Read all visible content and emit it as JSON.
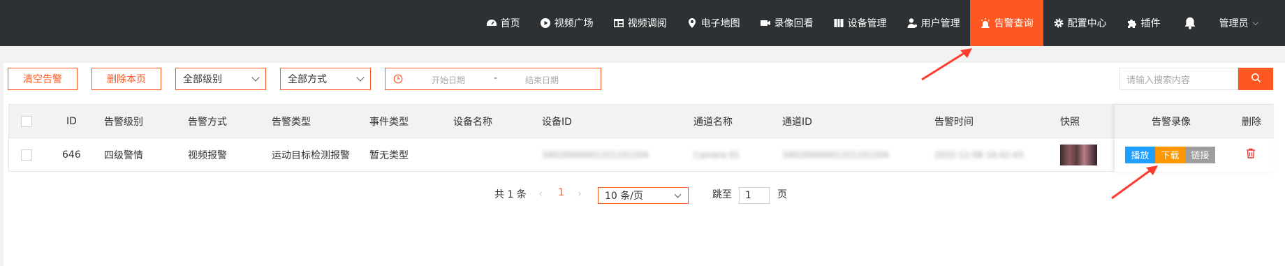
{
  "nav": {
    "items": [
      {
        "label": "首页",
        "icon": "dashboard-icon"
      },
      {
        "label": "视频广场",
        "icon": "play-circle-icon"
      },
      {
        "label": "视频调阅",
        "icon": "layout-icon"
      },
      {
        "label": "电子地图",
        "icon": "map-pin-icon"
      },
      {
        "label": "录像回看",
        "icon": "video-camera-icon"
      },
      {
        "label": "设备管理",
        "icon": "device-icon"
      },
      {
        "label": "用户管理",
        "icon": "user-icon"
      },
      {
        "label": "告警查询",
        "icon": "alarm-light-icon"
      },
      {
        "label": "配置中心",
        "icon": "gear-icon"
      },
      {
        "label": "插件",
        "icon": "puzzle-icon"
      }
    ],
    "active_label": "告警查询",
    "user": "管理员",
    "accent": "#ff5722",
    "bg": "#2e3133"
  },
  "toolbar": {
    "clear_label": "清空告警",
    "delete_page_label": "删除本页",
    "level_select": "全部级别",
    "method_select": "全部方式",
    "start_placeholder": "开始日期",
    "end_placeholder": "结束日期",
    "date_sep": "-",
    "search_placeholder": "请输入搜索内容"
  },
  "table": {
    "headers": {
      "id": "ID",
      "level": "告警级别",
      "method": "告警方式",
      "type": "告警类型",
      "event": "事件类型",
      "device_name": "设备名称",
      "device_id": "设备ID",
      "channel_name": "通道名称",
      "channel_id": "通道ID",
      "time": "告警时间",
      "snapshot": "快照",
      "record": "告警录像",
      "delete": "删除"
    },
    "row": {
      "id": "646",
      "level": "四级警情",
      "method": "视频报警",
      "type": "运动目标检测报警",
      "event": "暂无类型",
      "device_name": "",
      "device_id": "34020000001321101204",
      "channel_name": "Camera 01",
      "channel_id": "34020000001321101204",
      "time": "2022-12-08 16:42:43"
    },
    "actions": {
      "play": "播放",
      "download": "下载",
      "link": "链接"
    }
  },
  "pagination": {
    "total": "共 1 条",
    "current_page": "1",
    "page_size": "10 条/页",
    "jump_label": "跳至",
    "jump_value": "1",
    "page_suffix": "页"
  }
}
